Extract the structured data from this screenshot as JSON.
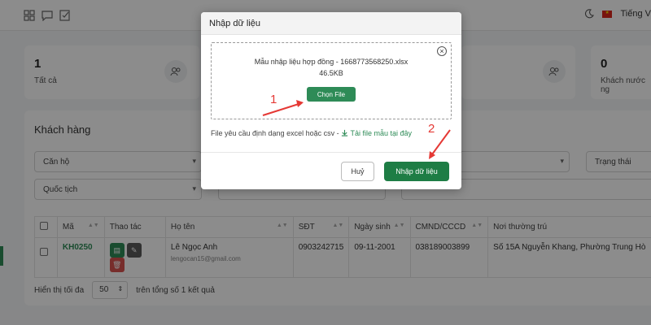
{
  "header": {
    "language": "Tiếng V",
    "icons": [
      "grid-icon",
      "chat-icon",
      "checklist-icon",
      "moon-icon",
      "vietnam-flag-icon"
    ]
  },
  "stats": [
    {
      "value": "1",
      "label": "Tất cả"
    },
    {
      "value": "0",
      "label": "Khách nước ng"
    }
  ],
  "customers": {
    "title": "Khách hàng",
    "filters": {
      "apartment": "Căn hộ",
      "nationality": "Quốc tịch",
      "status": "Trạng thái"
    },
    "columns": [
      "Mã",
      "Thao tác",
      "Họ tên",
      "SĐT",
      "Ngày sinh",
      "CMND/CCCD",
      "Nơi thường trú"
    ],
    "rows": [
      {
        "code": "KH0250",
        "name": "Lê Ngọc Anh",
        "email": "lengocan15@gmail.com",
        "phone": "0903242715",
        "dob": "09-11-2001",
        "id_number": "038189003899",
        "address": "Số 15A Nguyễn Khang, Phường Trung Hò"
      }
    ],
    "paging": {
      "show_label": "Hiển thị tối đa",
      "page_size": "50",
      "total_label": "trên tổng số 1 kết quả"
    }
  },
  "modal": {
    "title": "Nhập dữ liệu",
    "file_name": "Mẫu nhập liệu hợp đồng - 1668773568250.xlsx",
    "file_size": "46.5KB",
    "choose_button": "Chọn File",
    "hint_text": "File yêu cầu định dạng excel hoặc csv -",
    "template_link": "Tải file mẫu tại đây",
    "cancel_button": "Huỷ",
    "import_button": "Nhập dữ liệu"
  },
  "annotations": [
    "1",
    "2"
  ],
  "colors": {
    "primary_green": "#2e8b57",
    "import_green": "#1e7d45",
    "annotation_red": "#e53935",
    "delete_red": "#d9534f",
    "edit_gray": "#5a5a5a"
  }
}
